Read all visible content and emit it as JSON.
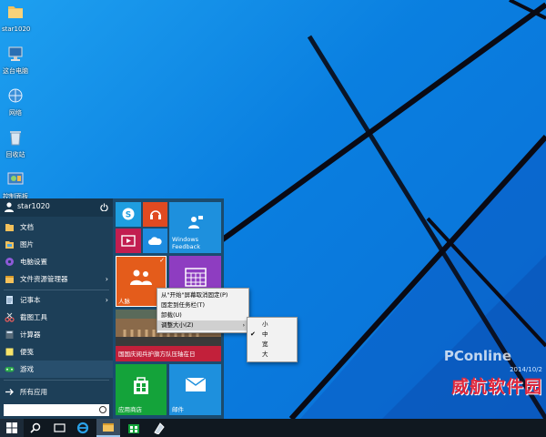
{
  "desktop": {
    "icons": [
      {
        "label": "star1020",
        "icon": "user-folder-icon"
      },
      {
        "label": "这台电脑",
        "icon": "computer-icon"
      },
      {
        "label": "网络",
        "icon": "network-icon"
      },
      {
        "label": "回收站",
        "icon": "recycle-bin-icon"
      },
      {
        "label": "控制面板",
        "icon": "control-panel-icon"
      }
    ]
  },
  "watermark": {
    "brand": "PConline",
    "date": "2014/10/2",
    "cn": "威航软件园"
  },
  "start_menu": {
    "user": "star1020",
    "items": [
      {
        "label": "文档",
        "icon": "documents-icon",
        "color": "#f3c15b"
      },
      {
        "label": "图片",
        "icon": "pictures-icon",
        "color": "#f3c15b"
      },
      {
        "label": "电脑设置",
        "icon": "settings-gear-icon",
        "color": "#8e5ad8"
      },
      {
        "label": "文件资源管理器",
        "icon": "file-explorer-icon",
        "color": "#f3c15b",
        "arrow": "›"
      },
      {
        "label": "记事本",
        "icon": "notepad-icon",
        "color": "#cfe3f7",
        "arrow": "›"
      },
      {
        "label": "截图工具",
        "icon": "snipping-tool-icon",
        "color": "#e85d5d"
      },
      {
        "label": "计算器",
        "icon": "calculator-icon",
        "color": "#5a6c7a"
      },
      {
        "label": "便笺",
        "icon": "sticky-notes-icon",
        "color": "#f8e46a"
      },
      {
        "label": "游戏",
        "icon": "games-icon",
        "color": "#2aa84a"
      },
      {
        "label": "所有应用",
        "icon": "arrow-right-icon",
        "color": "#ffffff"
      }
    ],
    "search_placeholder": ""
  },
  "tiles": {
    "windows_feedback": "Windows Feedback",
    "people": "人脉",
    "news": "国国庆阅兵护旗方队压轴在日",
    "store": "应用商店",
    "mail": "邮件"
  },
  "context_menu": {
    "items": [
      "从\"开始\"屏幕取消固定(P)",
      "固定到任务栏(T)",
      "卸载(U)",
      "调整大小(Z)"
    ],
    "submenu_arrow": "›"
  },
  "size_submenu": {
    "items": [
      "小",
      "中",
      "宽",
      "大"
    ],
    "checked": "中",
    "check_mark": "✔"
  },
  "colors": {
    "desktop": "#0a7fe0",
    "start_menu": "#1d3f58",
    "taskbar": "#101820",
    "accent_blue": "#1e90dd",
    "store_green": "#14a33a",
    "people_orange": "#e45c1b"
  }
}
